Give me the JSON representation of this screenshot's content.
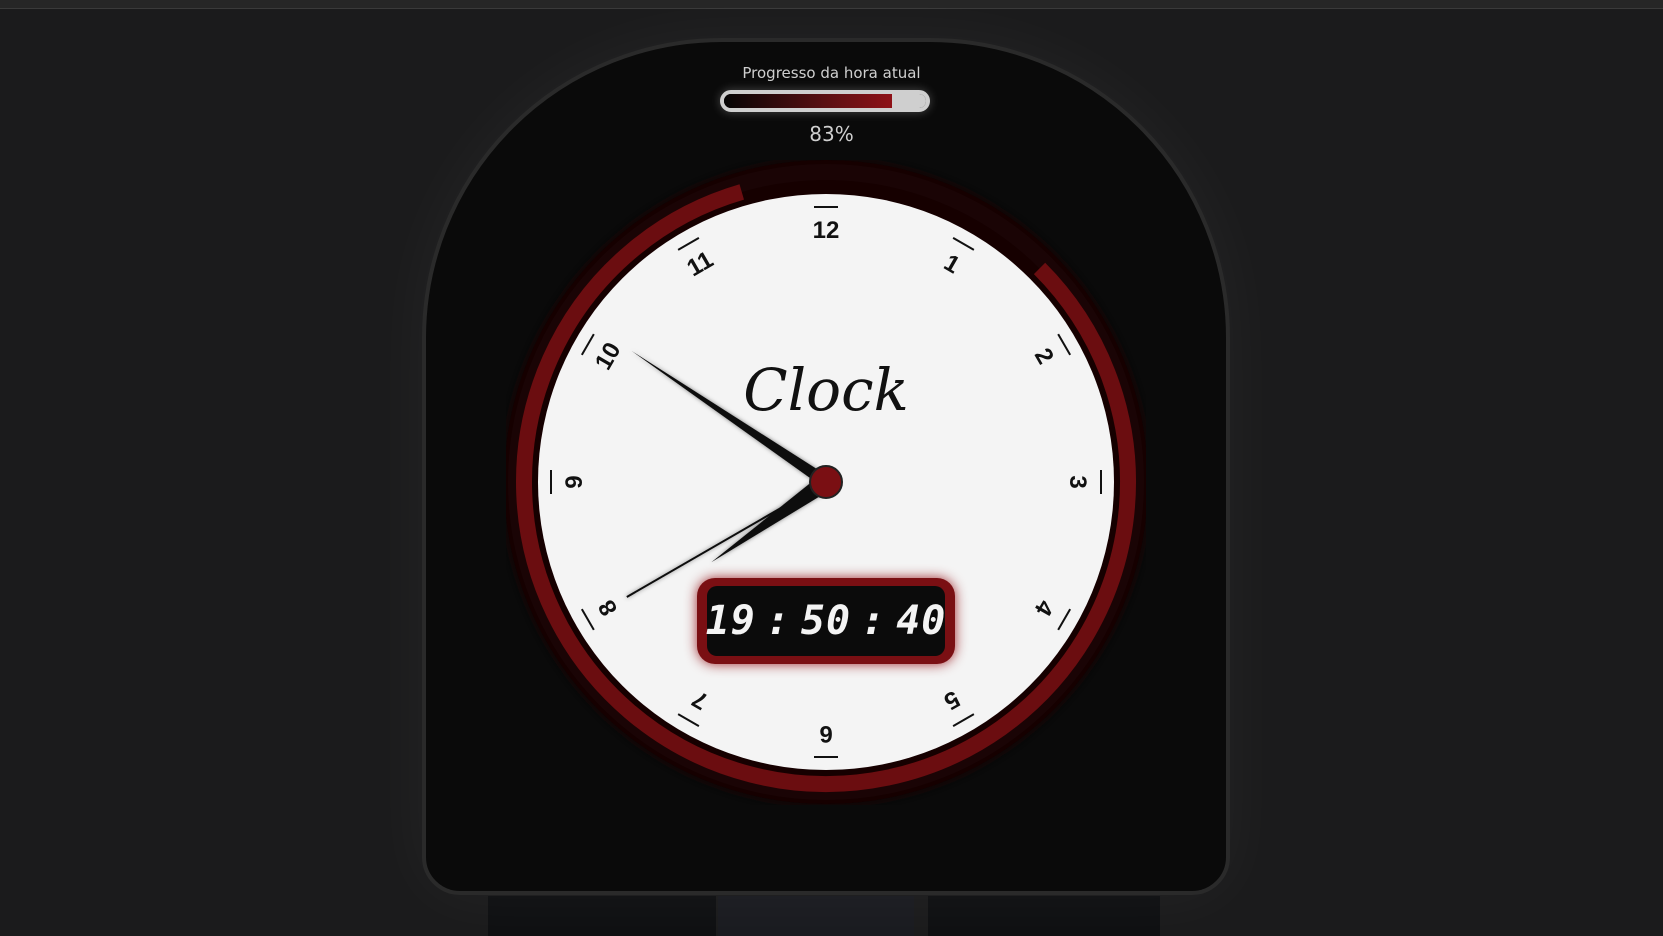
{
  "progress": {
    "title": "Progresso da hora atual",
    "percent_label": "83%",
    "value": 0.83
  },
  "clock": {
    "brand": "Clock",
    "numerals": [
      "12",
      "1",
      "2",
      "3",
      "4",
      "5",
      "6",
      "7",
      "8",
      "9",
      "10",
      "11"
    ],
    "time": {
      "hours": 19,
      "minutes": 50,
      "seconds": 40
    },
    "ring_progress": 0.83
  },
  "digital": {
    "hours": "19",
    "minutes": "50",
    "seconds": "40",
    "separator": ":"
  },
  "colors": {
    "accent": "#6b0d10",
    "accent_bright": "#8e1117",
    "face": "#f4f4f4",
    "card": "#0a0a0a",
    "background": "#1b1b1c"
  }
}
